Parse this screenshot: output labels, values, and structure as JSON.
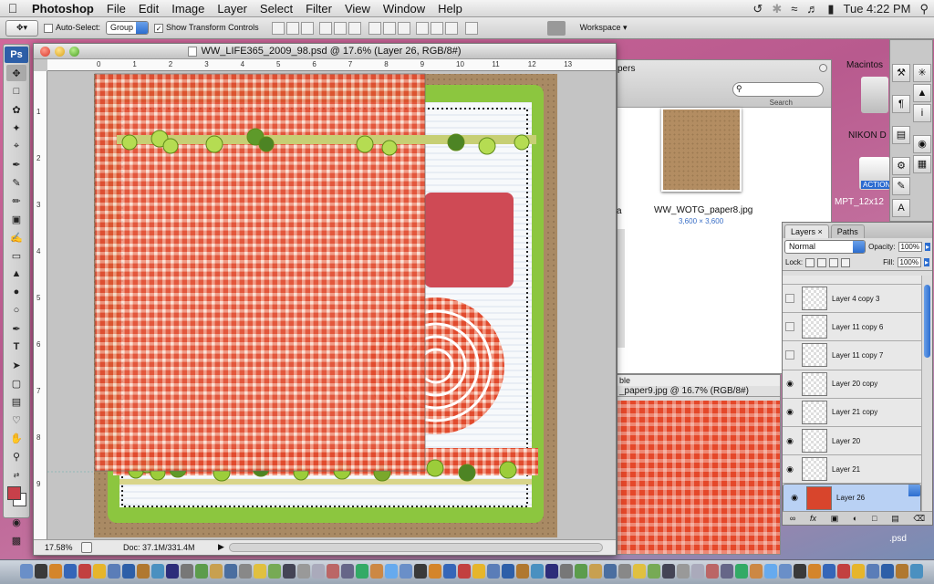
{
  "menubar": {
    "app": "Photoshop",
    "items": [
      "File",
      "Edit",
      "Image",
      "Layer",
      "Select",
      "Filter",
      "View",
      "Window",
      "Help"
    ],
    "clock": "Tue 4:22 PM"
  },
  "options": {
    "auto_select": "Auto-Select:",
    "group": "Group",
    "show_transform": "Show Transform Controls",
    "workspace": "Workspace"
  },
  "tools": {
    "badge": "Ps"
  },
  "document": {
    "title": "WW_LIFE365_2009_98.psd @ 17.6% (Layer 26, RGB/8#)",
    "zoom": "17.58%",
    "doc_info": "Doc: 37.1M/331.4M",
    "ruler_h": [
      "0",
      "1",
      "2",
      "3",
      "4",
      "5",
      "6",
      "7",
      "8",
      "9",
      "10",
      "11",
      "12",
      "13"
    ],
    "ruler_v": [
      "1",
      "2",
      "3",
      "4",
      "5",
      "6",
      "7",
      "8",
      "9"
    ]
  },
  "finder": {
    "partial_title": "pers",
    "search_label": "Search",
    "file_name": "WW_WOTG_paper8.jpg",
    "file_dims": "3,600 × 3,600",
    "side_a": "a",
    "side_b": "g"
  },
  "doc2": {
    "title": "_paper9.jpg @ 16.7% (RGB/8#)",
    "partial": "ble"
  },
  "desktop": {
    "hd": "Macintos",
    "nikon": "NIKON D",
    "action": "ACTION",
    "mpt": "MPT_12x12",
    "tn": "tn",
    "psd": ".psd"
  },
  "layers": {
    "tab_layers": "Layers",
    "tab_paths": "Paths",
    "blend": "Normal",
    "opacity_label": "Opacity:",
    "opacity": "100%",
    "lock_label": "Lock:",
    "fill_label": "Fill:",
    "fill": "100%",
    "rows": [
      {
        "name": "Layer 4 copy 3",
        "visible": false
      },
      {
        "name": "Layer 11 copy 6",
        "visible": false
      },
      {
        "name": "Layer 11 copy 7",
        "visible": false
      },
      {
        "name": "Layer 20 copy",
        "visible": true
      },
      {
        "name": "Layer 21 copy",
        "visible": true
      },
      {
        "name": "Layer 20",
        "visible": true
      },
      {
        "name": "Layer 21",
        "visible": true
      },
      {
        "name": "Layer 26",
        "visible": true,
        "selected": true
      }
    ]
  },
  "colors": {
    "red_gingham": "#e14b2e",
    "green_dot": "#8cc63f",
    "kraft": "#a98a64",
    "selection": "#b9d1f4"
  }
}
